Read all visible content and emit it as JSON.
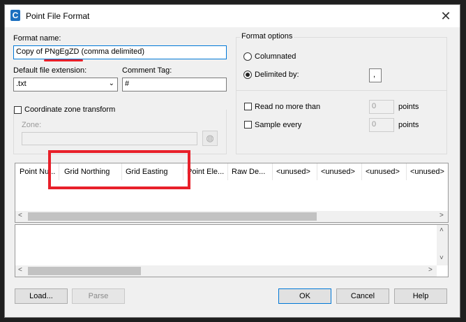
{
  "window": {
    "title": "Point File Format",
    "app_icon_letter": "C",
    "close_glyph": "✕"
  },
  "format_name": {
    "label": "Format name:",
    "value": "Copy of PNgEgZD (comma delimited)"
  },
  "default_ext": {
    "label": "Default file extension:",
    "value": ".txt",
    "chevron": "⌄"
  },
  "comment_tag": {
    "label": "Comment Tag:",
    "value": "#"
  },
  "coordinate_zone": {
    "checkbox_label": "Coordinate zone transform",
    "checked": false,
    "zone_label": "Zone:",
    "zone_value": "",
    "globe_glyph": "◍"
  },
  "format_options": {
    "title": "Format options",
    "columnated_label": "Columnated",
    "delimited_label": "Delimited by:",
    "selected": "delimited",
    "delimiter_value": ",",
    "read_no_more_label": "Read no more than",
    "read_no_more_value": "0",
    "read_no_more_unit": "points",
    "sample_every_label": "Sample every",
    "sample_every_value": "0",
    "sample_every_unit": "points"
  },
  "columns": [
    "Point Nu...",
    "Grid Northing",
    "Grid Easting",
    "Point Ele...",
    "Raw De...",
    "<unused>",
    "<unused>",
    "<unused>",
    "<unused>"
  ],
  "scroll": {
    "left": "<",
    "right": ">",
    "up": "˄",
    "down": "˅"
  },
  "buttons": {
    "load": "Load...",
    "parse": "Parse",
    "ok": "OK",
    "cancel": "Cancel",
    "help": "Help"
  },
  "colors": {
    "annotation_red": "#e8202a",
    "focus_blue": "#0078d7"
  }
}
